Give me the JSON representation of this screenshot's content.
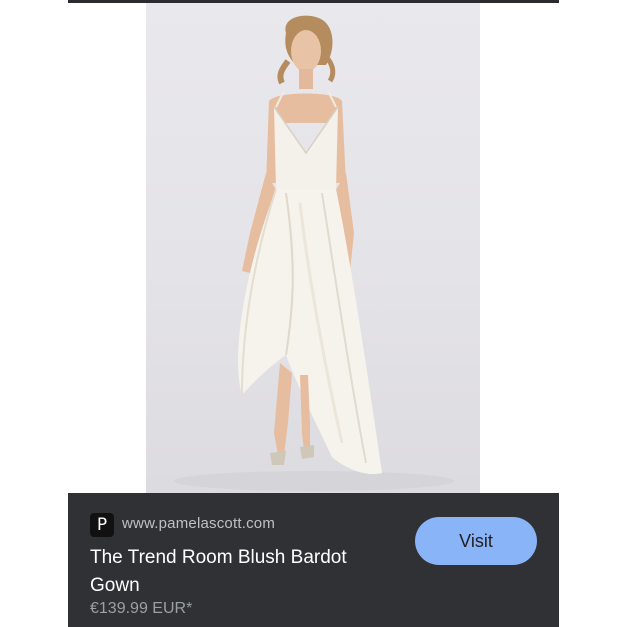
{
  "product_image": {
    "icon": "white-satin-gown-photo"
  },
  "result_card": {
    "favicon_letter": "P",
    "domain": "www.pamelascott.com",
    "title": "The Trend Room Blush Bardot Gown",
    "price": "€139.99 EUR*",
    "visit_label": "Visit",
    "colors": {
      "card_bg": "#303134",
      "button_bg": "#8ab4f8",
      "title": "#ffffff",
      "domain": "#bdc1c6",
      "price": "#9aa0a6"
    }
  }
}
